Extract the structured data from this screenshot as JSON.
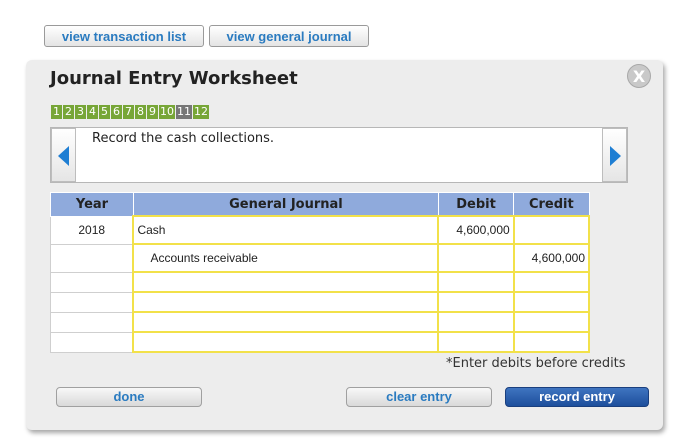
{
  "top_buttons": {
    "transaction_list": "view transaction list",
    "general_journal": "view general journal"
  },
  "panel": {
    "title": "Journal Entry Worksheet",
    "close_glyph": "X",
    "steps": [
      "1",
      "2",
      "3",
      "4",
      "5",
      "6",
      "7",
      "8",
      "9",
      "10",
      "11",
      "12"
    ],
    "active_step": "11",
    "description": "Record the cash collections."
  },
  "table": {
    "headers": [
      "Year",
      "General Journal",
      "Debit",
      "Credit"
    ],
    "rows": [
      {
        "year": "2018",
        "account": "Cash",
        "debit": "4,600,000",
        "credit": ""
      },
      {
        "year": "",
        "account": "Accounts receivable",
        "debit": "",
        "credit": "4,600,000"
      },
      {
        "year": "",
        "account": "",
        "debit": "",
        "credit": ""
      },
      {
        "year": "",
        "account": "",
        "debit": "",
        "credit": ""
      },
      {
        "year": "",
        "account": "",
        "debit": "",
        "credit": ""
      },
      {
        "year": "",
        "account": "",
        "debit": "",
        "credit": ""
      }
    ]
  },
  "note": "*Enter debits before credits",
  "bottom_buttons": {
    "done": "done",
    "clear": "clear entry",
    "record": "record entry"
  },
  "colors": {
    "link_blue": "#2a7bc0",
    "step_green": "#77a637",
    "step_active": "#777777",
    "header_blue": "#8faadc",
    "cell_border_yellow": "#f2e14a",
    "record_button": "#1d4f9c"
  },
  "icons": {
    "prev": "arrow-left-icon",
    "next": "arrow-right-icon",
    "close": "close-icon"
  }
}
